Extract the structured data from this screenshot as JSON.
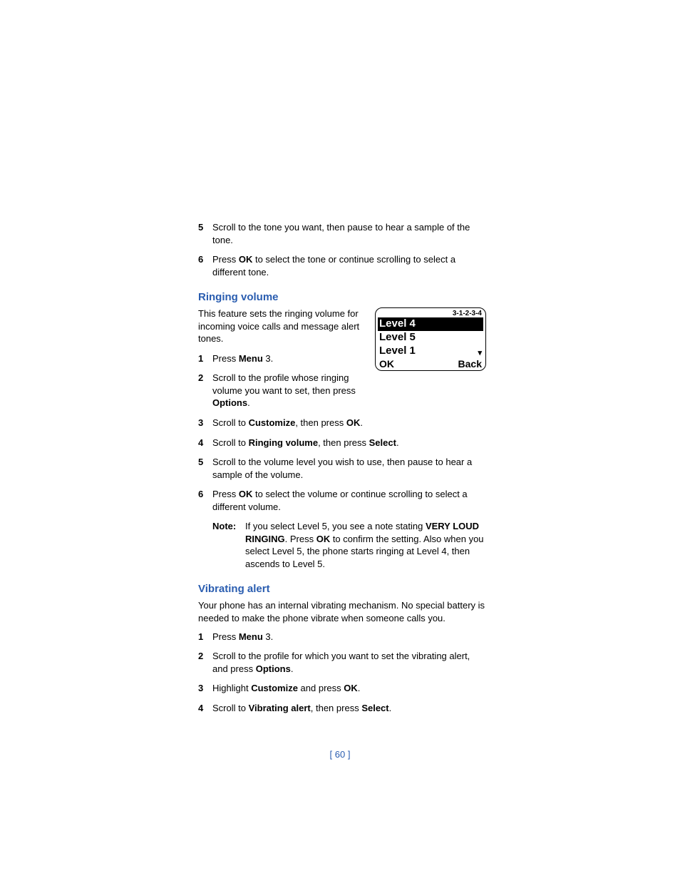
{
  "top_steps": [
    {
      "num": "5",
      "parts": [
        "Scroll to the tone you want, then pause to hear a sample of the tone."
      ]
    },
    {
      "num": "6",
      "parts": [
        "Press ",
        {
          "b": "OK"
        },
        " to select the tone or continue scrolling to select a different tone."
      ]
    }
  ],
  "section_ringing": {
    "heading": "Ringing volume",
    "intro": "This feature sets the ringing volume for incoming voice calls and message alert tones.",
    "steps": [
      {
        "num": "1",
        "parts": [
          "Press ",
          {
            "b": "Menu"
          },
          " 3."
        ]
      },
      {
        "num": "2",
        "parts": [
          "Scroll to the profile whose ringing volume you want to set, then press ",
          {
            "b": "Options"
          },
          "."
        ]
      },
      {
        "num": "3",
        "parts": [
          "Scroll to ",
          {
            "b": "Customize"
          },
          ", then press ",
          {
            "b": "OK"
          },
          "."
        ]
      },
      {
        "num": "4",
        "parts": [
          "Scroll to ",
          {
            "b": "Ringing volume"
          },
          ", then press ",
          {
            "b": "Select"
          },
          "."
        ]
      },
      {
        "num": "5",
        "parts": [
          "Scroll to the volume level you wish to use, then pause to hear a sample of the volume."
        ]
      },
      {
        "num": "6",
        "parts": [
          "Press ",
          {
            "b": "OK"
          },
          " to select the volume or continue scrolling to select a different volume."
        ]
      }
    ],
    "note_label": "Note:",
    "note_parts": [
      "If you select Level 5, you see a note stating ",
      {
        "b": "VERY LOUD RINGING"
      },
      ". Press ",
      {
        "b": "OK"
      },
      " to confirm the setting. Also when you select Level 5, the phone starts ringing at Level 4, then ascends to Level 5."
    ]
  },
  "screen": {
    "menu_path": "3-1-2-3-4",
    "rows": [
      {
        "label": "Level 4",
        "selected": true
      },
      {
        "label": "Level 5",
        "selected": false
      },
      {
        "label": "Level 1",
        "selected": false
      }
    ],
    "soft_left": "OK",
    "soft_right": "Back"
  },
  "section_vibrating": {
    "heading": "Vibrating alert",
    "intro": "Your phone has an internal vibrating mechanism. No special battery is needed to make the phone vibrate when someone calls you.",
    "steps": [
      {
        "num": "1",
        "parts": [
          "Press ",
          {
            "b": "Menu"
          },
          " 3."
        ]
      },
      {
        "num": "2",
        "parts": [
          "Scroll to the profile for which you want to set the vibrating alert, and press ",
          {
            "b": "Options"
          },
          "."
        ]
      },
      {
        "num": "3",
        "parts": [
          "Highlight ",
          {
            "b": "Customize"
          },
          " and press ",
          {
            "b": "OK"
          },
          "."
        ]
      },
      {
        "num": "4",
        "parts": [
          "Scroll to ",
          {
            "b": "Vibrating alert"
          },
          ", then press ",
          {
            "b": "Select"
          },
          "."
        ]
      }
    ]
  },
  "page_number": "[ 60 ]"
}
